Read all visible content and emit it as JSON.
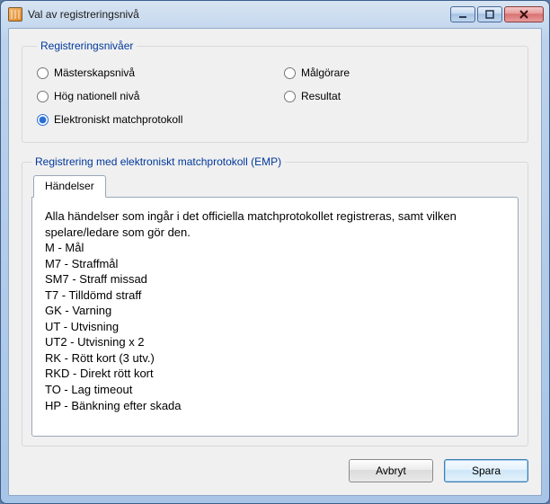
{
  "window": {
    "title": "Val av registreringsnivå"
  },
  "groupbox": {
    "legend": "Registreringsnivåer",
    "radios": [
      {
        "label": "Mästerskapsnivå",
        "checked": false
      },
      {
        "label": "Målgörare",
        "checked": false
      },
      {
        "label": "Hög nationell nivå",
        "checked": false
      },
      {
        "label": "Resultat",
        "checked": false
      },
      {
        "label": "Elektroniskt matchprotokoll",
        "checked": true
      }
    ]
  },
  "emp": {
    "legend": "Registrering med elektroniskt matchprotokoll (EMP)",
    "tabs": [
      {
        "label": "Händelser"
      }
    ],
    "content": {
      "intro": "Alla händelser som ingår i det officiella matchprotokollet registreras, samt vilken spelare/ledare som gör den.",
      "lines": [
        "M - Mål",
        "M7 - Straffmål",
        "SM7 - Straff missad",
        "T7 - Tilldömd straff",
        "GK - Varning",
        "UT - Utvisning",
        "UT2 - Utvisning x 2",
        "RK - Rött kort (3 utv.)",
        "RKD - Direkt rött kort",
        "TO - Lag timeout",
        "HP - Bänkning efter skada"
      ]
    }
  },
  "buttons": {
    "cancel": "Avbryt",
    "save": "Spara"
  }
}
